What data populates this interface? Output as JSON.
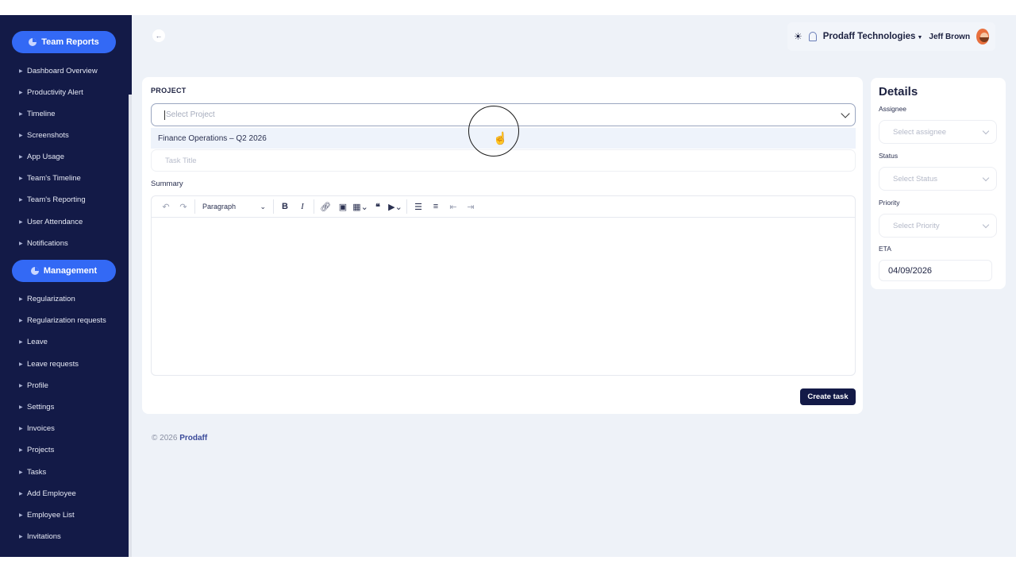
{
  "sidebar": {
    "team_reports_label": "Team Reports",
    "management_label": "Management",
    "team_items": [
      {
        "label": "Dashboard Overview"
      },
      {
        "label": "Productivity Alert"
      },
      {
        "label": "Timeline"
      },
      {
        "label": "Screenshots"
      },
      {
        "label": "App Usage"
      },
      {
        "label": "Team's Timeline"
      },
      {
        "label": "Team's Reporting"
      },
      {
        "label": "User Attendance"
      },
      {
        "label": "Notifications"
      }
    ],
    "management_items": [
      {
        "label": "Regularization"
      },
      {
        "label": "Regularization requests"
      },
      {
        "label": "Leave"
      },
      {
        "label": "Leave requests"
      },
      {
        "label": "Profile"
      },
      {
        "label": "Settings"
      },
      {
        "label": "Invoices"
      },
      {
        "label": "Projects"
      },
      {
        "label": "Tasks"
      },
      {
        "label": "Add Employee"
      },
      {
        "label": "Employee List"
      },
      {
        "label": "Invitations"
      }
    ]
  },
  "header": {
    "company": "Prodaff Technologies",
    "user": "Jeff Brown"
  },
  "form": {
    "project_label": "PROJECT",
    "project_placeholder": "Select Project",
    "project_option": "Finance Operations – Q2 2026",
    "task_title_placeholder": "Task Title",
    "summary_label": "Summary",
    "paragraph_label": "Paragraph",
    "create_button": "Create task"
  },
  "details": {
    "title": "Details",
    "assignee_label": "Assignee",
    "assignee_placeholder": "Select assignee",
    "status_label": "Status",
    "status_placeholder": "Select Status",
    "priority_label": "Priority",
    "priority_placeholder": "Select Priority",
    "eta_label": "ETA",
    "eta_value": "04/09/2026"
  },
  "footer": {
    "copyright": "© 2026",
    "brand": "Prodaff"
  },
  "colors": {
    "sidebar_bg": "#131a47",
    "accent": "#3369f5",
    "main_bg": "#eef2f8"
  }
}
